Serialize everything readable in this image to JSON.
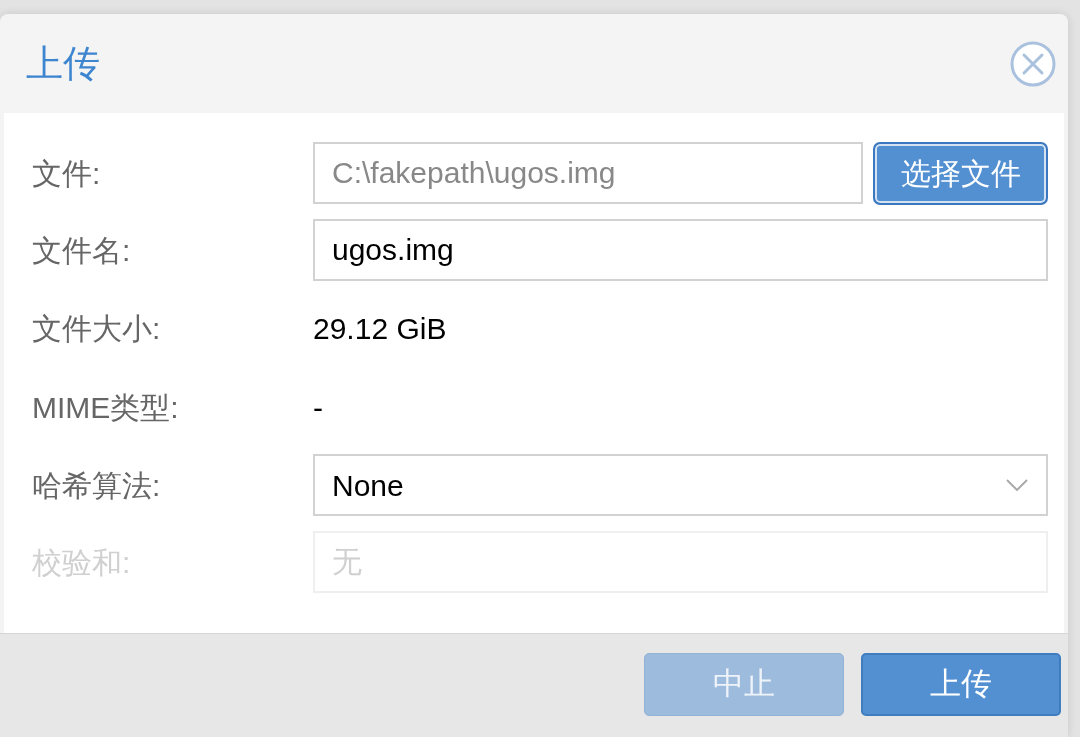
{
  "dialog": {
    "title": "上传",
    "fields": [
      {
        "kind": "file",
        "label": "文件:",
        "value": "C:\\fakepath\\ugos.img",
        "button": "选择文件",
        "disabled": false
      },
      {
        "kind": "text",
        "label": "文件名:",
        "value": "ugos.img",
        "disabled": false
      },
      {
        "kind": "display",
        "label": "文件大小:",
        "value": "29.12 GiB",
        "disabled": false
      },
      {
        "kind": "display",
        "label": "MIME类型:",
        "value": "-",
        "disabled": false
      },
      {
        "kind": "select",
        "label": "哈希算法:",
        "value": "None",
        "disabled": false
      },
      {
        "kind": "text",
        "label": "校验和:",
        "placeholder": "无",
        "disabled": true
      }
    ],
    "buttons": [
      {
        "label": "中止",
        "disabled": true
      },
      {
        "label": "上传",
        "disabled": false
      }
    ]
  }
}
